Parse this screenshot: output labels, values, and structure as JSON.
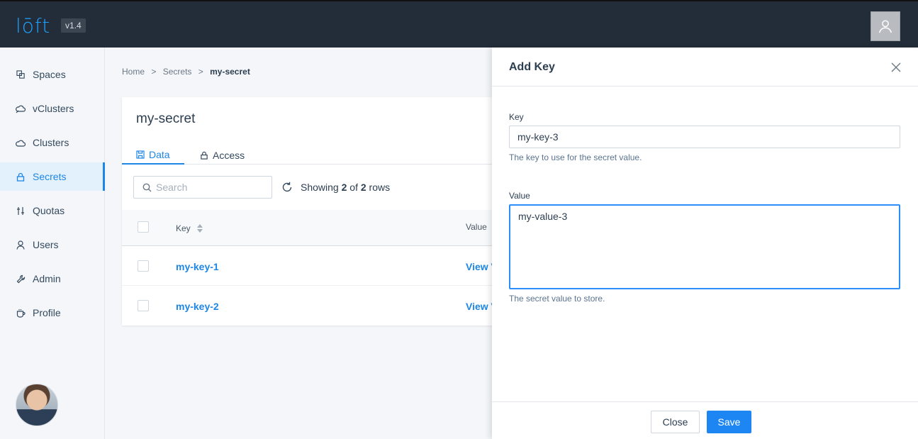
{
  "topbar": {
    "logo": "lōft",
    "version": "v1.4"
  },
  "sidebar": {
    "items": [
      {
        "label": "Spaces",
        "icon": "spaces-icon"
      },
      {
        "label": "vClusters",
        "icon": "vcluster-icon"
      },
      {
        "label": "Clusters",
        "icon": "cloud-icon"
      },
      {
        "label": "Secrets",
        "icon": "lock-icon",
        "active": true
      },
      {
        "label": "Quotas",
        "icon": "sliders-icon"
      },
      {
        "label": "Users",
        "icon": "user-icon"
      },
      {
        "label": "Admin",
        "icon": "wrench-icon"
      },
      {
        "label": "Profile",
        "icon": "coffee-icon"
      }
    ]
  },
  "breadcrumb": {
    "home": "Home",
    "sep1": ">",
    "secrets": "Secrets",
    "sep2": ">",
    "current": "my-secret"
  },
  "card": {
    "title": "my-secret",
    "tabs": [
      {
        "label": "Data"
      },
      {
        "label": "Access"
      }
    ],
    "search_placeholder": "Search",
    "showing": {
      "prefix": "Showing",
      "shown": "2",
      "of": "of",
      "total": "2",
      "suffix": "rows"
    },
    "columns": {
      "key": "Key",
      "value": "Value"
    },
    "rows": [
      {
        "key": "my-key-1",
        "value": "View V"
      },
      {
        "key": "my-key-2",
        "value": "View V"
      }
    ]
  },
  "drawer": {
    "title": "Add Key",
    "key_label": "Key",
    "key_value": "my-key-3",
    "key_hint": "The key to use for the secret value.",
    "value_label": "Value",
    "value_value": "my-value-3",
    "value_hint": "The secret value to store.",
    "close_label": "Close",
    "save_label": "Save"
  },
  "colors": {
    "accent": "#1d86e6",
    "topbar": "#232d39",
    "save": "#1d86f2"
  }
}
